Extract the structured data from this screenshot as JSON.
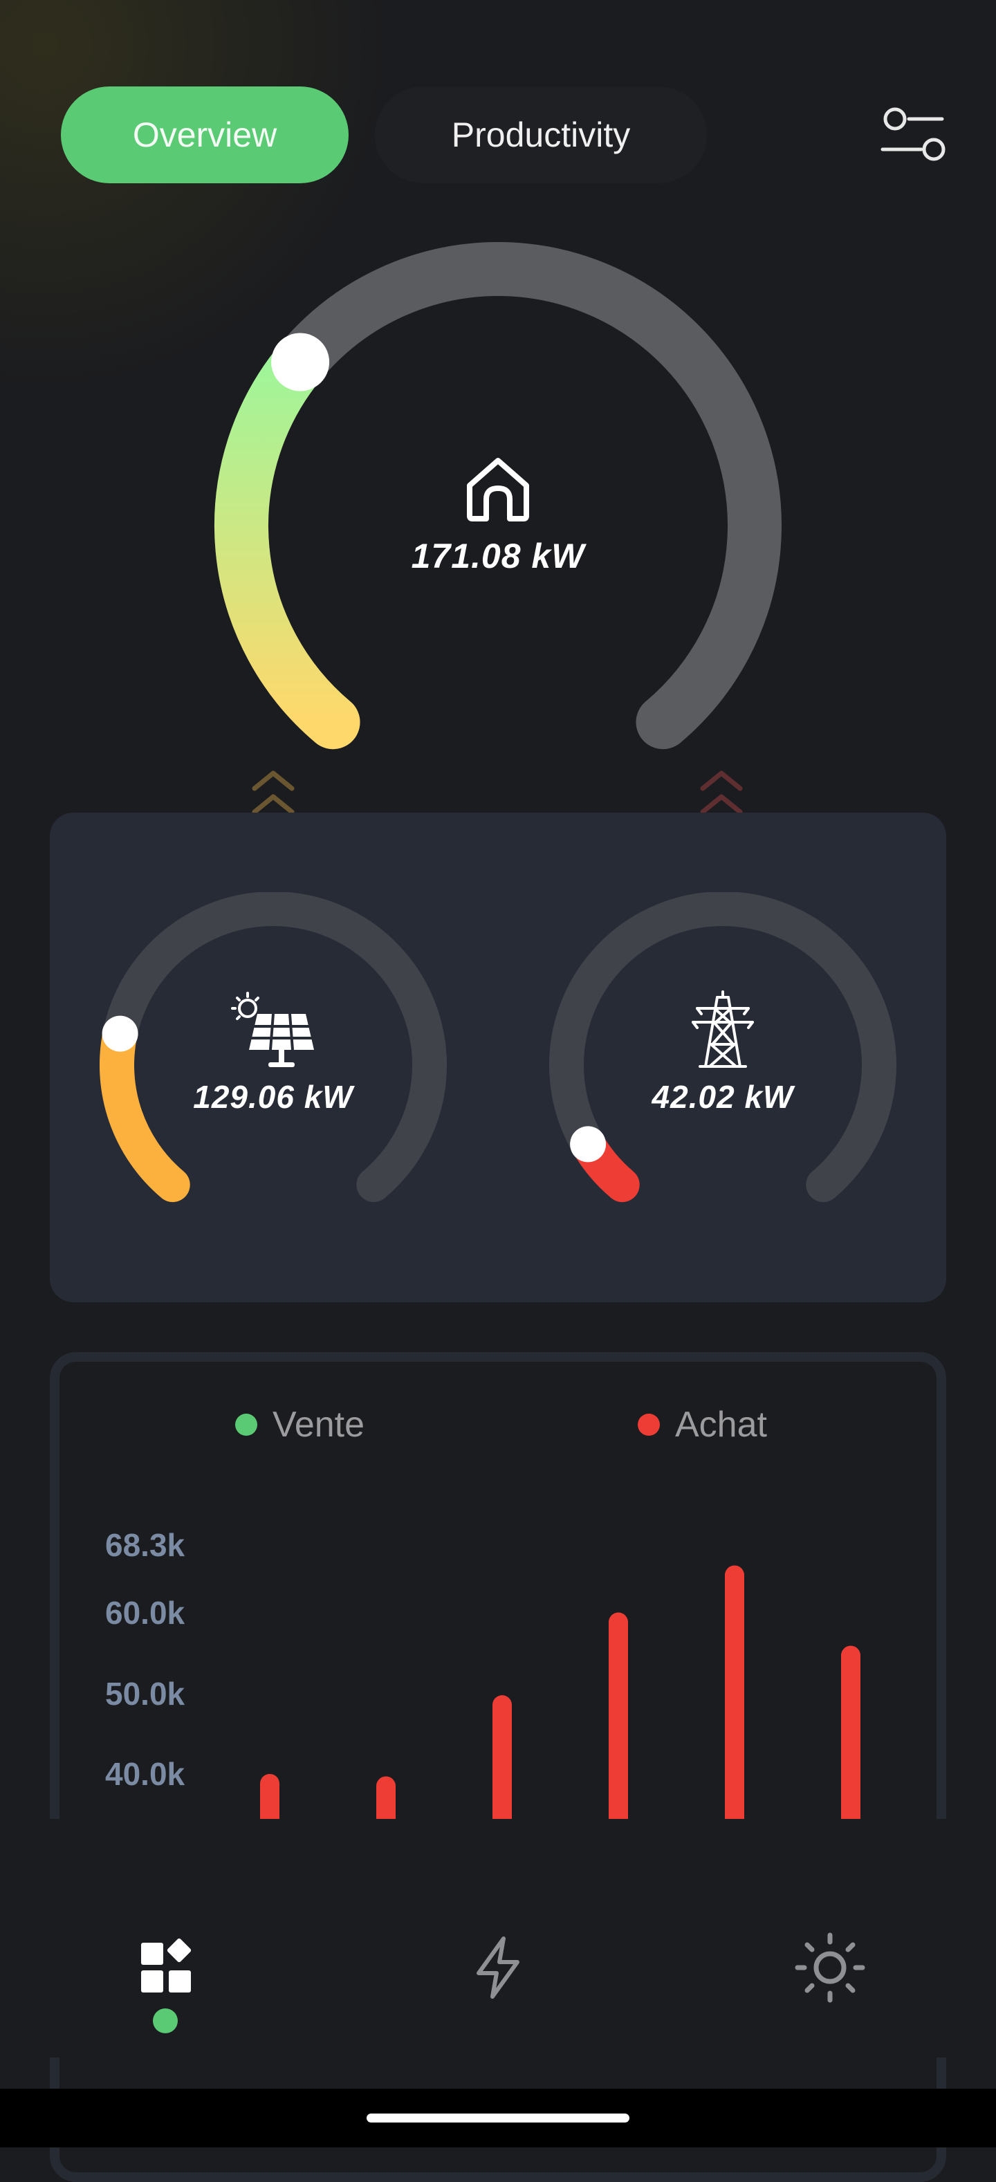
{
  "tabs": {
    "overview": "Overview",
    "productivity": "Productivity"
  },
  "home": {
    "icon": "house-icon",
    "value": "171.08 kW",
    "level": 0.32
  },
  "solar": {
    "icon": "solar-panel-icon",
    "value": "129.06 kW",
    "level": 0.22,
    "color": "#fcb13e"
  },
  "grid": {
    "icon": "power-tower-icon",
    "value": "42.02 kW",
    "level": 0.07,
    "color": "#ee3d34"
  },
  "chart_data": {
    "type": "bar",
    "legend": [
      "Vente",
      "Achat"
    ],
    "legend_colors": [
      "#5acb74",
      "#ee3d34"
    ],
    "y_ticks": [
      "68.3k",
      "60.0k",
      "50.0k",
      "40.0k"
    ],
    "ylim": [
      40000,
      68300
    ],
    "series": [
      {
        "name": "Achat",
        "color": "#ee3d34",
        "values": [
          40600,
          40300,
          50300,
          60500,
          66300,
          56400
        ]
      }
    ]
  },
  "nav": {
    "dashboard": "dashboard-icon",
    "energy": "lightning-icon",
    "settings": "sun-icon"
  }
}
